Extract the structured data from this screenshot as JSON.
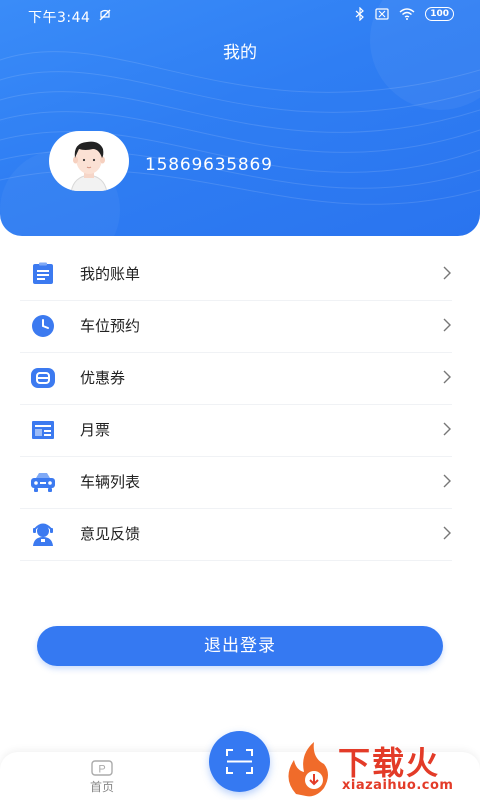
{
  "status_bar": {
    "time": "下午3:44",
    "battery": "100",
    "icons": [
      "dnd-icon",
      "bluetooth-icon",
      "sim-icon",
      "wifi-icon",
      "battery-icon"
    ]
  },
  "header": {
    "title": "我的",
    "phone": "15869635869"
  },
  "menu": {
    "items": [
      {
        "label": "我的账单",
        "icon": "bill-icon"
      },
      {
        "label": "车位预约",
        "icon": "clock-icon"
      },
      {
        "label": "优惠券",
        "icon": "coupon-icon"
      },
      {
        "label": "月票",
        "icon": "ticket-icon"
      },
      {
        "label": "车辆列表",
        "icon": "car-icon"
      },
      {
        "label": "意见反馈",
        "icon": "feedback-icon"
      }
    ]
  },
  "logout_label": "退出登录",
  "tabbar": {
    "home_label": "首页",
    "home_icon_glyph": "P",
    "scan_icon": "scan-icon"
  },
  "watermark": {
    "title": "下载火",
    "url": "xiazaihuo.com"
  },
  "colors": {
    "primary": "#3579f2",
    "icon": "#3c7af0",
    "watermark": "#e33b28"
  }
}
